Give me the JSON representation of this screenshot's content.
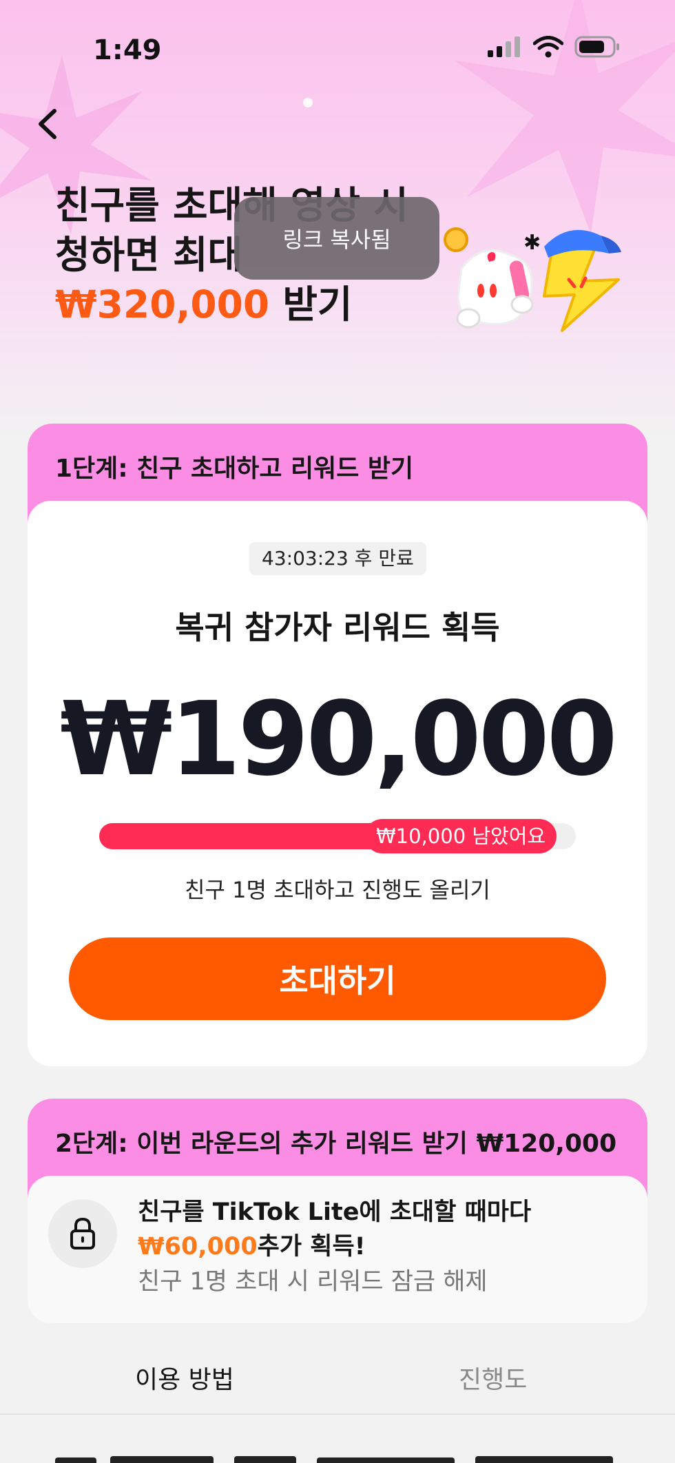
{
  "status_bar": {
    "time": "1:49"
  },
  "hero": {
    "title_line1": "친구를 초대해 영상 시",
    "title_line2": "청하면 최대",
    "title_amount": "₩320,000",
    "title_suffix": " 받기"
  },
  "toast": {
    "text": "링크 복사됨"
  },
  "step1": {
    "heading": "1단계: 친구 초대하고 리워드 받기",
    "expiry": "43:03:23 후 만료",
    "reward_label": "복귀 참가자 리워드 획득",
    "amount": "₩190,000",
    "progress_fraction": 0.95,
    "progress_text": "₩10,000 남았어요",
    "hint": "친구 1명 초대하고 진행도 올리기",
    "invite_button": "초대하기"
  },
  "step2": {
    "heading": "2단계: 이번 라운드의 추가 리워드 받기 ₩120,000",
    "line1": "친구를 TikTok Lite에 초대할 때마다",
    "line2_amount": "₩60,000",
    "line2_suffix": "추가 획득!",
    "sub": "친구 1명 초대 시 리워드 잠금 해제"
  },
  "tabs": {
    "how_to": "이용 방법",
    "progress": "진행도"
  },
  "colors": {
    "accent_orange": "#ff5a00",
    "progress_red": "#fe2c55",
    "pink_header": "#fb8ee4"
  },
  "icons": [
    "back-chevron-icon",
    "signal-icon",
    "wifi-icon",
    "battery-icon",
    "lock-icon"
  ]
}
